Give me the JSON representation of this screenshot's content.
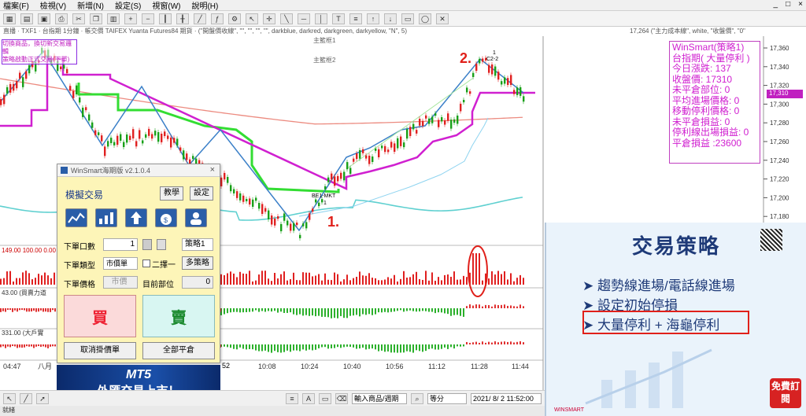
{
  "menu": [
    "檔案(F)",
    "檢視(V)",
    "新增(N)",
    "設定(S)",
    "視窗(W)",
    "說明(H)"
  ],
  "window_controls": [
    "_",
    "□",
    "×"
  ],
  "chart_header": "直播 · TXF1 · 台指期 1分鐘 · 帳交價 TAIFEX Yuanta Futures84 期貨 ·  (\"開盤價收線\", \"\", \"\", \"\", \"\", darkblue, darkred, darkgreen, darkyellow, \"N\", 5)",
  "chart_header_right": "17,264 (\"主力成本線\", white, \"收盤價\", \"0\"",
  "top_left_note": [
    "切換商品，換切新交易邏輯",
    "策略啟動正式交易(下單)"
  ],
  "legend_labels": [
    "主籃框1",
    "主籃框2"
  ],
  "y_ticks": [
    "17,360",
    "17,340",
    "17,320",
    "17,300",
    "17,280",
    "17,260",
    "17,240",
    "17,220",
    "17,200",
    "17,180"
  ],
  "current_price_tag": "17,310",
  "x_ticks": [
    "04:47",
    "八月",
    "10:08",
    "10:24",
    "10:40",
    "10:56",
    "11:12",
    "11:28",
    "11:44"
  ],
  "x_tick_pre": "52",
  "sub_labels": [
    "149.00  100.00  0.00",
    "43.00  (買賣力道",
    "331.00  (大戶實"
  ],
  "chart_labels": {
    "be": "BE1-MKT",
    "be_sub": "1",
    "c2": "C2-2",
    "c2_top": "1"
  },
  "annotations": {
    "a1": "1.",
    "a2": "2."
  },
  "infobox": [
    "WinSmart(策略1)",
    "台指期( 大量停利 )",
    "今日漲跌: 137",
    "收盤價: 17310",
    "未平倉部位: 0",
    "平均進場價格: 0",
    "移動停利價格: 0",
    "未平倉損益: 0",
    "停利線出場損益: 0",
    "平倉損益 :23600"
  ],
  "dialog": {
    "title": "WinSmart海期版 v2.1.0.4",
    "heading": "模擬交易",
    "btn_teach": "教學",
    "btn_settings": "設定",
    "lbl_qty": "下單口數",
    "qty_value": "1",
    "strategy_select": "策略1",
    "lbl_type": "下單類型",
    "type_select": "市價單",
    "chk_label": "二擇一",
    "btn_multi": "多策略",
    "lbl_price": "下單價格",
    "price_placeholder": "市價",
    "lbl_position": "目前部位",
    "position_value": "0",
    "buy": "買",
    "sell": "賣",
    "cancel_all": "取消掛價單",
    "close_all": "全部平倉"
  },
  "mt5": {
    "title": "MT5",
    "subtitle": "外匯交易上市！"
  },
  "panel": {
    "title": "交易策略",
    "items": [
      "趨勢線進場/電話線進場",
      "設定初始停損",
      "大量停利 + 海龜停利"
    ],
    "subscribe": "免費訂閱",
    "brand": "WINSMART"
  },
  "bottombar": {
    "product": "輸入商品/週期",
    "mode": "等分",
    "datetime": "2021/ 8/  2 11:52:00"
  },
  "statusbar": "就緒",
  "colors": {
    "magenta": "#d020d0",
    "green": "#33dd33",
    "blue_line": "#3a7fc8",
    "red_line": "#e45a4a",
    "up": "#e02020",
    "down": "#18a018"
  },
  "icons": [
    "chart-icon",
    "bar-chart-icon",
    "upload-icon",
    "money-bag-icon",
    "user-icon"
  ]
}
